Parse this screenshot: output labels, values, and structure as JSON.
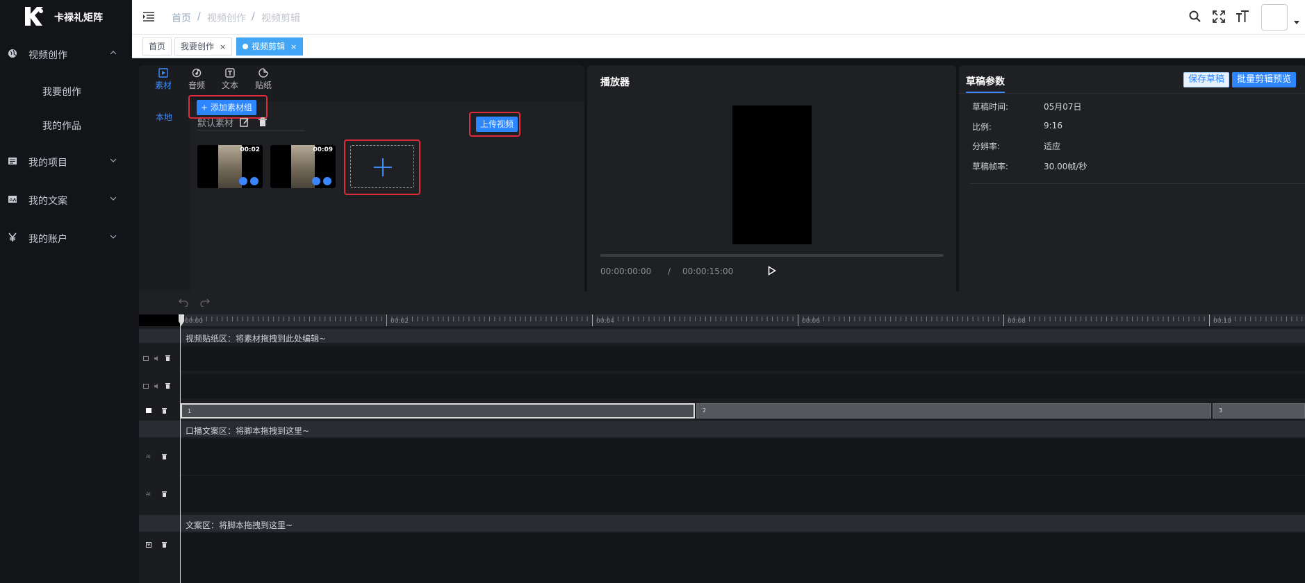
{
  "app": {
    "name": "卡禄礼矩阵"
  },
  "sidebar": {
    "items": [
      {
        "label": "视频创作",
        "icon": "globe-icon"
      },
      {
        "label": "我的项目",
        "icon": "document-icon"
      },
      {
        "label": "我的文案",
        "icon": "text-image-icon"
      },
      {
        "label": "我的账户",
        "icon": "yen-icon"
      }
    ],
    "sub_items": [
      "我要创作",
      "我的作品"
    ]
  },
  "header": {
    "breadcrumb": [
      "首页",
      "视频创作",
      "视频剪辑"
    ],
    "separator": "/"
  },
  "tags": [
    {
      "label": "首页",
      "closable": false,
      "active": false
    },
    {
      "label": "我要创作",
      "closable": true,
      "active": false
    },
    {
      "label": "视频剪辑",
      "closable": true,
      "active": true
    }
  ],
  "tag_close": "×",
  "material": {
    "tabs": [
      {
        "label": "素材",
        "icon": "media-icon"
      },
      {
        "label": "音频",
        "icon": "music-icon"
      },
      {
        "label": "文本",
        "icon": "text-icon"
      },
      {
        "label": "贴纸",
        "icon": "sticker-icon"
      }
    ],
    "side_label": "本地",
    "add_group_button": "+ 添加素材组",
    "group_name": "默认素材",
    "upload_button": "上传视频",
    "thumbs": [
      {
        "duration": "00:02"
      },
      {
        "duration": "00:09"
      }
    ]
  },
  "player": {
    "title": "播放器",
    "current_time": "00:00:00:00",
    "time_sep": "/",
    "total_time": "00:00:15:00"
  },
  "params": {
    "title": "草稿参数",
    "save_button": "保存草稿",
    "batch_button": "批量剪辑预览",
    "rows": [
      {
        "key": "草稿时间:",
        "value": "05月07日"
      },
      {
        "key": "比例:",
        "value": "9:16"
      },
      {
        "key": "分辨率:",
        "value": "适应"
      },
      {
        "key": "草稿帧率:",
        "value": "30.00帧/秒"
      }
    ]
  },
  "timeline": {
    "ruler_labels": [
      "00:00",
      "00:02",
      "00:04",
      "00:06",
      "00:08",
      "00:10"
    ],
    "zones": [
      "视频贴纸区：将素材拖拽到此处编辑~",
      "口播文案区：将脚本拖拽到这里~",
      "文案区：将脚本拖拽到这里~"
    ],
    "clips": [
      "1",
      "2",
      "3"
    ]
  },
  "colors": {
    "accent": "#2e86ff",
    "highlight": "#e02a3a",
    "panel": "#1f2024"
  }
}
